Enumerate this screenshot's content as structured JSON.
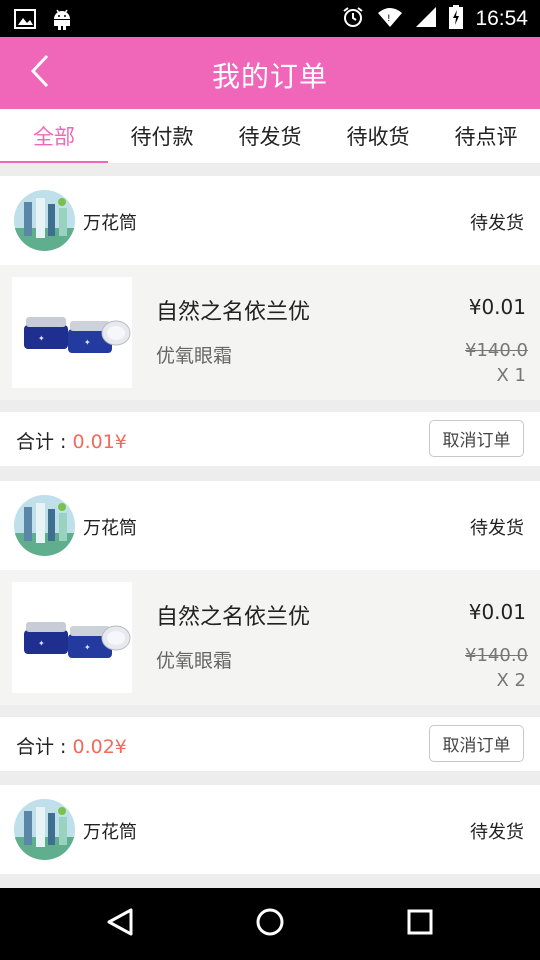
{
  "status_bar": {
    "time": "16:54",
    "icons": [
      "image-icon",
      "android-icon",
      "alarm-icon",
      "wifi-icon",
      "signal-icon",
      "battery-icon"
    ]
  },
  "header": {
    "title": "我的订单",
    "back_icon": "chevron-left-icon",
    "color": "#f067b9"
  },
  "tabs": [
    {
      "label": "全部",
      "active": true
    },
    {
      "label": "待付款",
      "active": false
    },
    {
      "label": "待发货",
      "active": false
    },
    {
      "label": "待收货",
      "active": false
    },
    {
      "label": "待点评",
      "active": false
    }
  ],
  "orders": [
    {
      "shop_name": "万花筒",
      "status": "待发货",
      "item": {
        "name": "自然之名依兰优",
        "desc": "优氧眼霜",
        "price": "¥0.01",
        "original_price": "¥140.0",
        "qty": "X 1"
      },
      "total_label": "合计 : ",
      "total_value": "0.01¥",
      "cancel_label": "取消订单"
    },
    {
      "shop_name": "万花筒",
      "status": "待发货",
      "item": {
        "name": "自然之名依兰优",
        "desc": "优氧眼霜",
        "price": "¥0.01",
        "original_price": "¥140.0",
        "qty": "X 2"
      },
      "total_label": "合计 : ",
      "total_value": "0.02¥",
      "cancel_label": "取消订单"
    },
    {
      "shop_name": "万花筒",
      "status": "待发货"
    }
  ],
  "nav_bar": {
    "icons": [
      "back-triangle-icon",
      "home-circle-icon",
      "recents-square-icon"
    ]
  },
  "colors": {
    "accent": "#f067b9",
    "price_red": "#f26a5a"
  }
}
